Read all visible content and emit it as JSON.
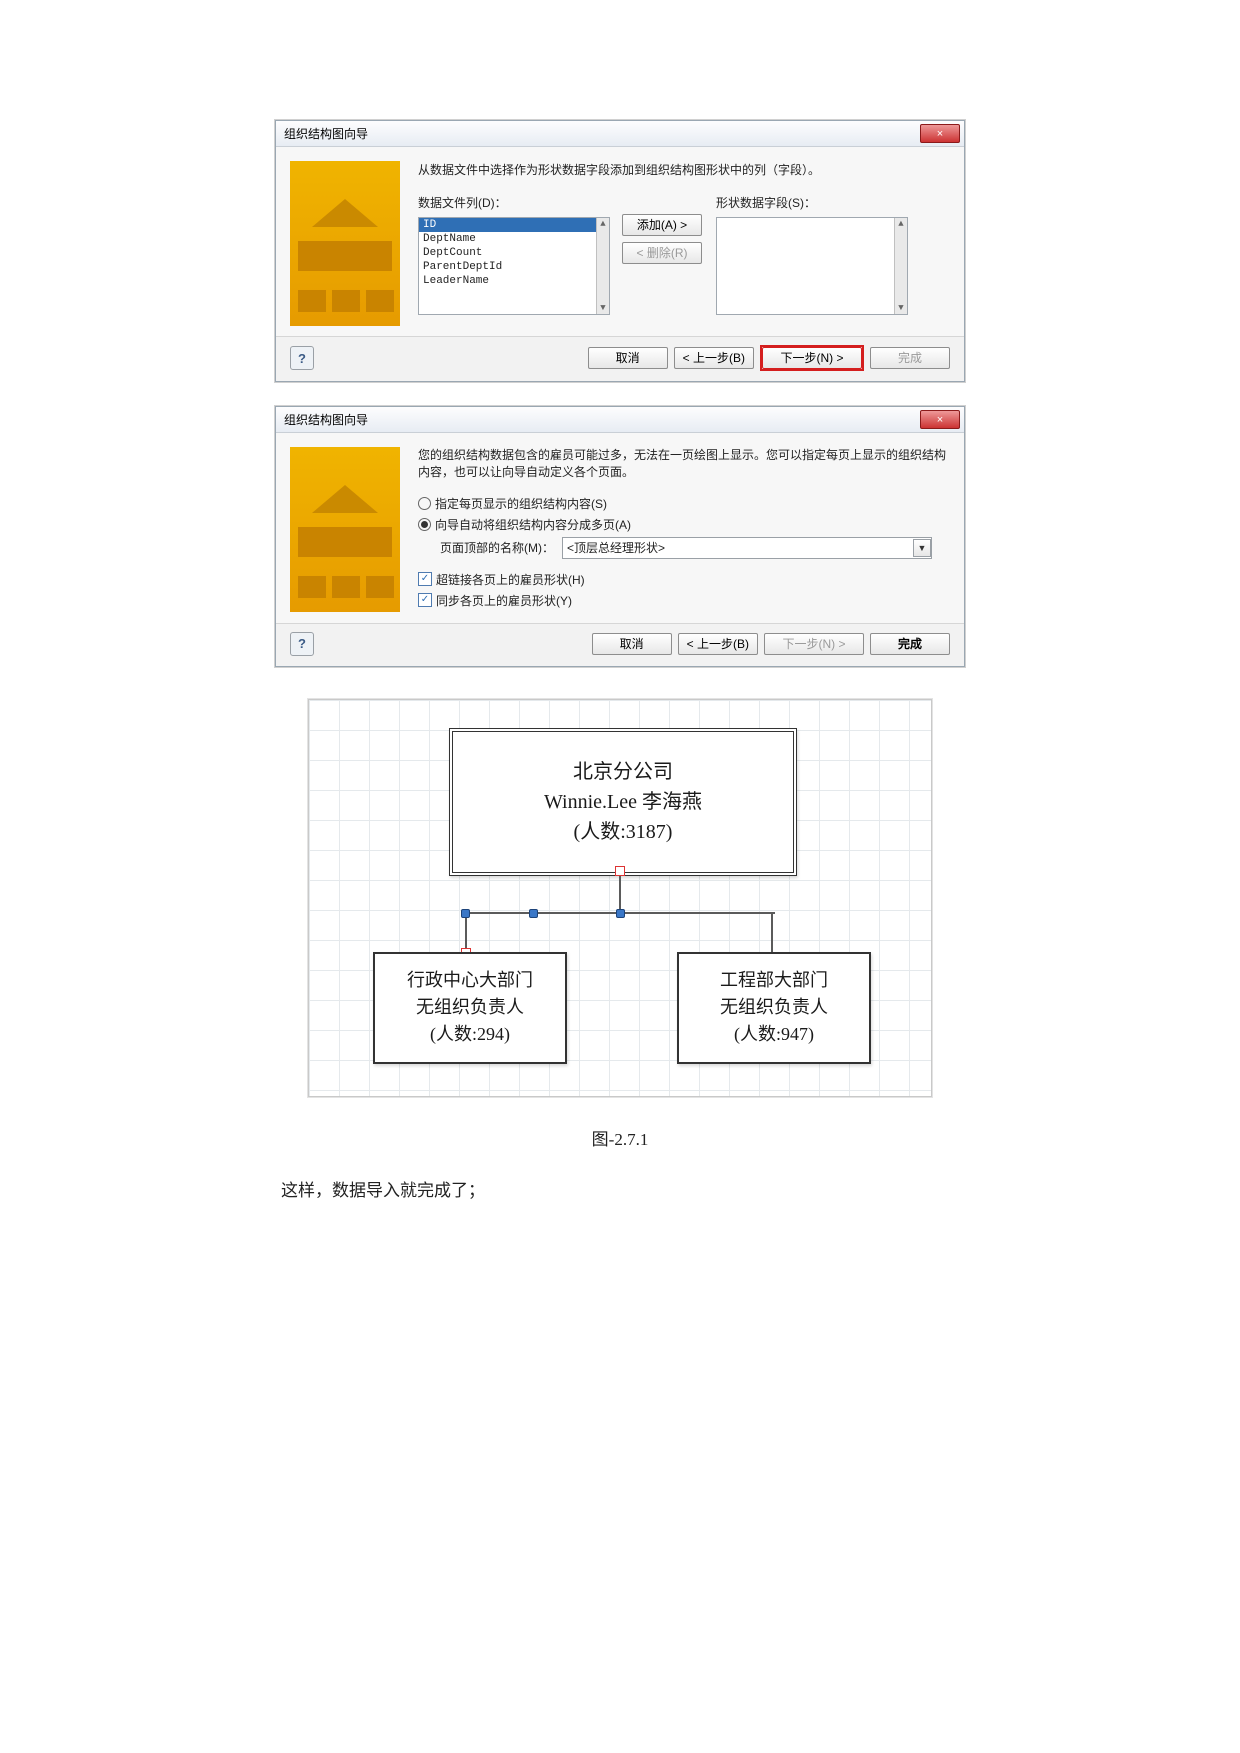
{
  "dialog1": {
    "title": "组织结构图向导",
    "close": "×",
    "instruction": "从数据文件中选择作为形状数据字段添加到组织结构图形状中的列（字段）。",
    "left_label": "数据文件列(D)：",
    "right_label": "形状数据字段(S)：",
    "columns": [
      "ID",
      "DeptName",
      "DeptCount",
      "ParentDeptId",
      "LeaderName"
    ],
    "selected_index": 0,
    "btn_add": "添加(A) >",
    "btn_remove": "< 删除(R)",
    "footer": {
      "help": "?",
      "cancel": "取消",
      "back": "< 上一步(B)",
      "next": "下一步(N) >",
      "finish": "完成"
    }
  },
  "dialog2": {
    "title": "组织结构图向导",
    "close": "×",
    "instruction": "您的组织结构数据包含的雇员可能过多，无法在一页绘图上显示。您可以指定每页上显示的组织结构内容，也可以让向导自动定义各个页面。",
    "opt_manual": "指定每页显示的组织结构内容(S)",
    "opt_auto": "向导自动将组织结构内容分成多页(A)",
    "top_name_label": "页面顶部的名称(M)：",
    "top_name_value": "<顶层总经理形状>",
    "chk_link": "超链接各页上的雇员形状(H)",
    "chk_sync": "同步各页上的雇员形状(Y)",
    "footer": {
      "help": "?",
      "cancel": "取消",
      "back": "< 上一步(B)",
      "next": "下一步(N) >",
      "finish": "完成"
    }
  },
  "chart_data": {
    "type": "tree",
    "root": {
      "line1": "北京分公司",
      "line2": "Winnie.Lee 李海燕",
      "line3": "(人数:3187)"
    },
    "children": [
      {
        "line1": "行政中心大部门",
        "line2": "无组织负责人",
        "line3": "(人数:294)"
      },
      {
        "line1": "工程部大部门",
        "line2": "无组织负责人",
        "line3": "(人数:947)"
      }
    ]
  },
  "caption": "图-2.7.1",
  "bodytext": "这样，数据导入就完成了；"
}
